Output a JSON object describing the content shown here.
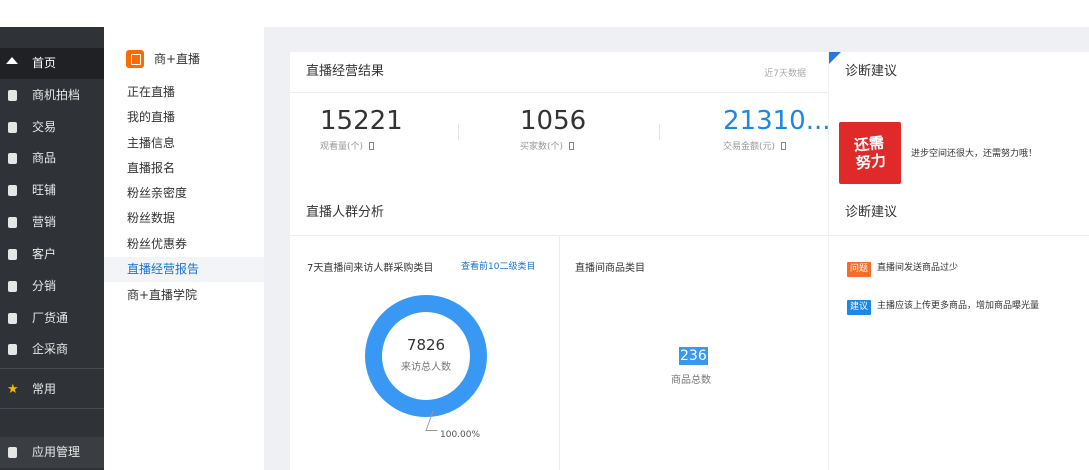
{
  "rail": {
    "items": [
      {
        "label": "首页",
        "icon": "home-icon"
      },
      {
        "label": "商机拍档",
        "icon": "handshake-icon"
      },
      {
        "label": "交易",
        "icon": "trade-icon"
      },
      {
        "label": "商品",
        "icon": "goods-icon"
      },
      {
        "label": "旺铺",
        "icon": "shop-icon"
      },
      {
        "label": "营销",
        "icon": "marketing-icon"
      },
      {
        "label": "客户",
        "icon": "customer-icon"
      },
      {
        "label": "分销",
        "icon": "distribution-icon"
      },
      {
        "label": "厂货通",
        "icon": "factory-icon"
      },
      {
        "label": "企采商",
        "icon": "procurement-icon"
      },
      {
        "label": "常用",
        "icon": "star-icon"
      },
      {
        "label": "应用管理",
        "icon": "app-icon"
      }
    ]
  },
  "submenu": {
    "header": "商+直播",
    "items": [
      "正在直播",
      "我的直播",
      "主播信息",
      "直播报名",
      "粉丝亲密度",
      "粉丝数据",
      "粉丝优惠券",
      "直播经营报告",
      "商+直播学院"
    ],
    "active_index": 7
  },
  "results": {
    "title": "直播经营结果",
    "note": "近7天数据",
    "metrics": [
      {
        "value": "15221",
        "label": "观看量(个)"
      },
      {
        "value": "1056",
        "label": "买家数(个)"
      },
      {
        "value": "21310...",
        "label": "交易金额(元)"
      }
    ]
  },
  "diag_top": {
    "title": "诊断建议",
    "stamp": [
      "还需",
      "努力"
    ],
    "text": "进步空间还很大，还需努力哦！"
  },
  "crowd": {
    "title": "直播人群分析",
    "left_title": "7天直播间来访人群采购类目",
    "link": "查看前10二级类目",
    "donut_value": "7826",
    "donut_label": "来访总人数",
    "donut_percent": "100.00%",
    "donut_share": 1.0,
    "right_title": "直播间商品类目",
    "goods_value": "236",
    "goods_label": "商品总数"
  },
  "diag_bottom": {
    "title": "诊断建议",
    "items": [
      {
        "tag": "问题",
        "text": "直播间发送商品过少",
        "color": "#f56c2a"
      },
      {
        "tag": "建议",
        "text": "主播应该上传更多商品，增加商品曝光量",
        "color": "#1b87e6"
      }
    ]
  }
}
